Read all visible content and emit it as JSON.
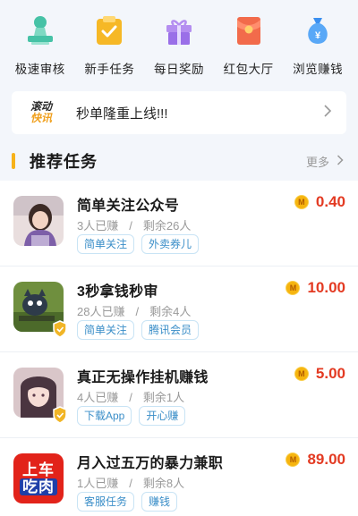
{
  "quicknav": [
    {
      "icon": "fast-review-icon",
      "label": "极速审核"
    },
    {
      "icon": "newbie-task-icon",
      "label": "新手任务"
    },
    {
      "icon": "daily-reward-icon",
      "label": "每日奖励"
    },
    {
      "icon": "red-envelope-icon",
      "label": "红包大厅"
    },
    {
      "icon": "browse-earn-icon",
      "label": "浏览赚钱"
    }
  ],
  "news": {
    "logo_line1": "滚动",
    "logo_line2": "快讯",
    "text": "秒单隆重上线!!!"
  },
  "section": {
    "title": "推荐任务",
    "more": "更多"
  },
  "tasks": [
    {
      "title": "简单关注公众号",
      "earned": "3人已赚",
      "remaining": "剩余26人",
      "tags": [
        "简单关注",
        "外卖券儿"
      ],
      "reward": "0.40"
    },
    {
      "title": "3秒拿钱秒审",
      "earned": "28人已赚",
      "remaining": "剩余4人",
      "tags": [
        "简单关注",
        "腾讯会员"
      ],
      "reward": "10.00"
    },
    {
      "title": "真正无操作挂机赚钱",
      "earned": "4人已赚",
      "remaining": "剩余1人",
      "tags": [
        "下载App",
        "开心赚"
      ],
      "reward": "5.00"
    },
    {
      "title": "月入过五万的暴力兼职",
      "earned": "1人已赚",
      "remaining": "剩余8人",
      "tags": [
        "客服任务",
        "赚钱"
      ],
      "reward": "89.00"
    }
  ],
  "task4_avatar": {
    "line1": "上车",
    "line2": "吃肉"
  },
  "colors": {
    "accent": "#f7b21a",
    "reward": "#e33a22",
    "tag": "#3a8ec8"
  },
  "coin_glyph": "M"
}
